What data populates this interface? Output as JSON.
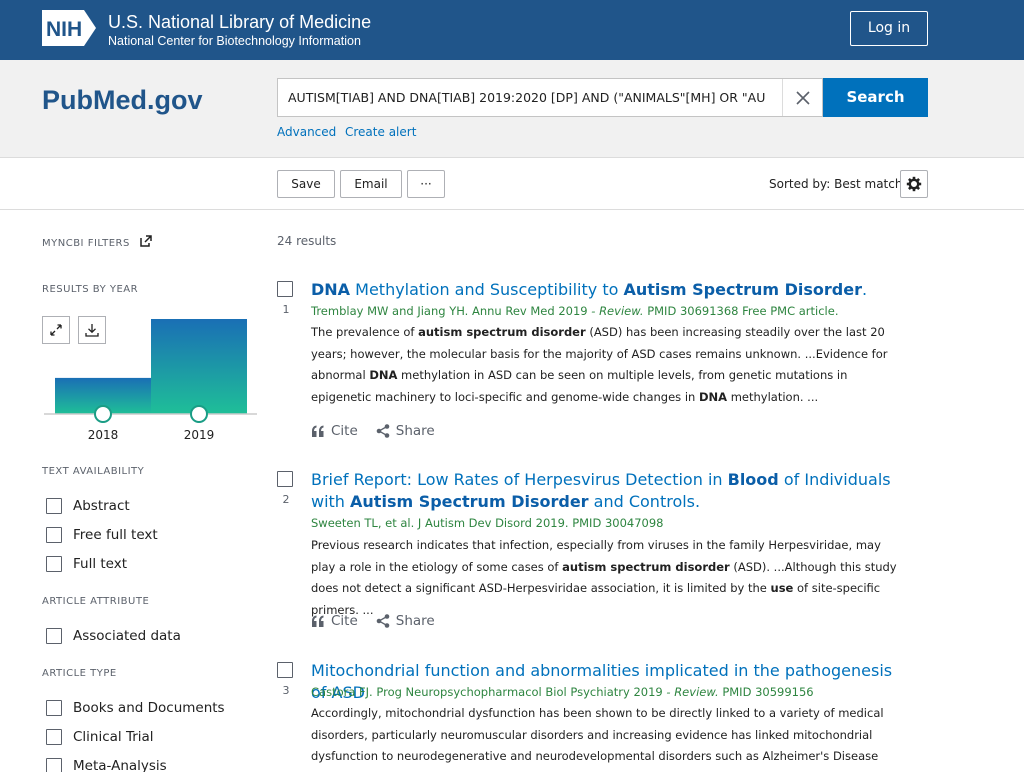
{
  "nih": {
    "logo_text": "NIH",
    "title": "U.S. National Library of Medicine",
    "subtitle": "National Center for Biotechnology Information",
    "login_label": "Log in"
  },
  "pubmed": {
    "logo_text": "PubMed.gov",
    "search_value": "AUTISM[TIAB] AND DNA[TIAB] 2019:2020 [DP] AND (\"ANIMALS\"[MH] OR \"AU",
    "search_label": "Search",
    "advanced_label": "Advanced",
    "create_alert_label": "Create alert"
  },
  "toolbar": {
    "save_label": "Save",
    "email_label": "Email",
    "more_label": "···",
    "sorted_label": "Sorted by: Best match"
  },
  "sidebar": {
    "myncbi_label": "MYNCBI FILTERS",
    "results_by_year_label": "RESULTS BY YEAR",
    "text_availability_label": "TEXT AVAILABILITY",
    "text_availability": [
      "Abstract",
      "Free full text",
      "Full text"
    ],
    "article_attribute_label": "ARTICLE ATTRIBUTE",
    "article_attribute": [
      "Associated data"
    ],
    "article_type_label": "ARTICLE TYPE",
    "article_type": [
      "Books and Documents",
      "Clinical Trial",
      "Meta-Analysis"
    ]
  },
  "chart_data": {
    "type": "bar",
    "categories": [
      "2018",
      "2019"
    ],
    "values": [
      0.38,
      1.0
    ],
    "colors": [
      "#1fb5a0",
      "#1a6fb5"
    ]
  },
  "results": {
    "count_label": "24 results",
    "items": [
      {
        "num": "1",
        "title_parts": [
          {
            "t": "DNA",
            "b": true
          },
          {
            "t": " Methylation and Susceptibility to ",
            "b": false
          },
          {
            "t": "Autism Spectrum Disorder",
            "b": true
          },
          {
            "t": ".",
            "b": false
          }
        ],
        "citation": "Tremblay MW and Jiang YH. Annu Rev Med 2019",
        "citation_review": " - Review.",
        "citation_tail": " PMID 30691368 Free PMC article.",
        "snippet_parts": [
          {
            "t": "The prevalence of ",
            "b": false
          },
          {
            "t": "autism spectrum disorder",
            "b": true
          },
          {
            "t": " (ASD) has been increasing steadily over the last 20 years; however, the molecular basis for the majority of ASD cases remains unknown. ...Evidence for abnormal ",
            "b": false
          },
          {
            "t": "DNA",
            "b": true
          },
          {
            "t": " methylation in ASD can be seen on multiple levels, from genetic mutations in epigenetic machinery to loci-specific and genome-wide changes in ",
            "b": false
          },
          {
            "t": "DNA",
            "b": true
          },
          {
            "t": " methylation. ...",
            "b": false
          }
        ],
        "cite_label": "Cite",
        "share_label": "Share"
      },
      {
        "num": "2",
        "title_parts": [
          {
            "t": "Brief Report: Low Rates of Herpesvirus Detection in ",
            "b": false
          },
          {
            "t": "Blood",
            "b": true
          },
          {
            "t": " of Individuals with ",
            "b": false
          },
          {
            "t": "Autism Spectrum Disorder",
            "b": true
          },
          {
            "t": " and Controls.",
            "b": false
          }
        ],
        "citation": "Sweeten TL, et al. J Autism Dev Disord 2019. PMID 30047098",
        "citation_review": "",
        "citation_tail": "",
        "snippet_parts": [
          {
            "t": "Previous research indicates that infection, especially from viruses in the family Herpesviridae, may play a role in the etiology of some cases of ",
            "b": false
          },
          {
            "t": "autism spectrum disorder",
            "b": true
          },
          {
            "t": " (ASD). ...Although this study does not detect a significant ASD-Herpesviridae association, it is limited by the ",
            "b": false
          },
          {
            "t": "use",
            "b": true
          },
          {
            "t": " of site-specific primers. ...",
            "b": false
          }
        ],
        "cite_label": "Cite",
        "share_label": "Share"
      },
      {
        "num": "3",
        "title_parts": [
          {
            "t": "Mitochondrial function and abnormalities implicated in the pathogenesis of ASD",
            "b": false
          }
        ],
        "citation": "Castora FJ. Prog Neuropsychopharmacol Biol Psychiatry 2019",
        "citation_review": " - Review.",
        "citation_tail": " PMID 30599156",
        "snippet_parts": [
          {
            "t": "Accordingly, mitochondrial dysfunction has been shown to be directly linked to a variety of medical disorders, particularly neuromuscular disorders and increasing evidence has linked mitochondrial dysfunction to neurodegenerative and neurodevelopmental disorders such as Alzheimer's Disease (AD),",
            "b": false
          }
        ],
        "cite_label": "",
        "share_label": ""
      }
    ]
  }
}
